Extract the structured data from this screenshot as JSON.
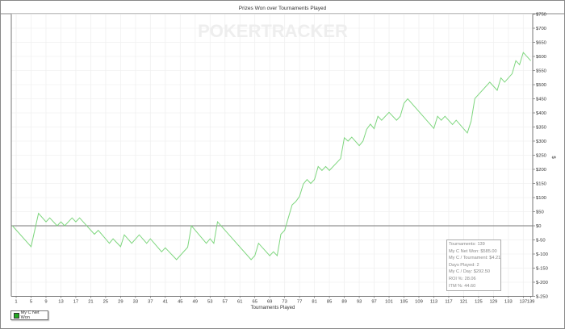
{
  "chart_data": {
    "type": "line",
    "title": "Prizes Won over Tournaments Played",
    "watermark": "POKERTRACKER",
    "xlabel": "Tournaments Played",
    "ylabel": "$",
    "xlim": [
      0,
      139
    ],
    "ylim": [
      -250,
      750
    ],
    "grid": true,
    "y_axis_side": "right",
    "x_ticks": [
      1,
      5,
      9,
      13,
      17,
      21,
      25,
      29,
      33,
      37,
      41,
      45,
      49,
      53,
      57,
      61,
      65,
      69,
      73,
      77,
      81,
      85,
      89,
      93,
      97,
      101,
      105,
      109,
      113,
      117,
      121,
      125,
      129,
      133,
      137,
      139
    ],
    "y_ticks": [
      "$-250",
      "$-200",
      "$-150",
      "$-100",
      "$-50",
      "$0",
      "$50",
      "$100",
      "$150",
      "$200",
      "$250",
      "$300",
      "$350",
      "$400",
      "$450",
      "$500",
      "$550",
      "$600",
      "$650",
      "$700",
      "$750"
    ],
    "y_tick_values": [
      -250,
      -200,
      -150,
      -100,
      -50,
      0,
      50,
      100,
      150,
      200,
      250,
      300,
      350,
      400,
      450,
      500,
      550,
      600,
      650,
      700,
      750
    ],
    "legend_position": "bottom-left",
    "series": [
      {
        "name": "My C Net Won",
        "color": "#7ed67e",
        "x": [
          0,
          5,
          7,
          9,
          10,
          12,
          13,
          14,
          16,
          17,
          18,
          22,
          23,
          26,
          27,
          29,
          30,
          32,
          34,
          36,
          37,
          40,
          41,
          44,
          47,
          48,
          52,
          53,
          54,
          55,
          64,
          65,
          66,
          69,
          70,
          71,
          72,
          73,
          75,
          76,
          77,
          78,
          79,
          80,
          81,
          82,
          83,
          84,
          85,
          88,
          89,
          90,
          91,
          93,
          94,
          95,
          96,
          97,
          98,
          99,
          101,
          103,
          104,
          105,
          106,
          113,
          114,
          115,
          116,
          118,
          119,
          122,
          123,
          124,
          128,
          130,
          131,
          132,
          134,
          135,
          136,
          137,
          139
        ],
        "y": [
          0,
          -74,
          44,
          14,
          28,
          0,
          14,
          0,
          28,
          14,
          28,
          -30,
          -16,
          -62,
          -46,
          -74,
          -32,
          -62,
          -32,
          -62,
          -46,
          -92,
          -78,
          -120,
          -76,
          0,
          -62,
          -46,
          -62,
          14,
          -120,
          -106,
          -62,
          -106,
          -92,
          -106,
          -30,
          -16,
          74,
          86,
          104,
          148,
          164,
          150,
          164,
          210,
          196,
          210,
          196,
          238,
          312,
          300,
          314,
          284,
          300,
          342,
          360,
          344,
          388,
          374,
          402,
          374,
          388,
          434,
          450,
          345,
          388,
          374,
          388,
          359,
          374,
          329,
          371,
          451,
          509,
          480,
          524,
          509,
          539,
          585,
          571,
          614,
          585
        ]
      }
    ],
    "stats": [
      "Tournaments: 139",
      "My C Net Won: $585.00",
      "My C / Tournament: $4.21",
      "Days Played: 2",
      "My C / Day: $292.50",
      "ROI %: 28.06",
      "ITM %: 44.60"
    ],
    "legend_color": "#22aa22",
    "axis_color": "#777777"
  }
}
